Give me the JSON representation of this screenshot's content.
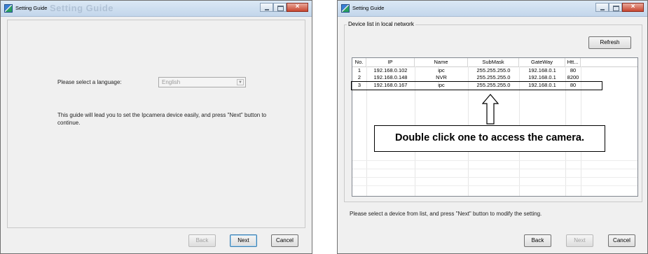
{
  "window1": {
    "title": "Setting Guide",
    "ghost_title": "Setting Guide",
    "language_label": "Please select a language:",
    "language_value": "English",
    "guide_text_line1": "This guide will lead you to set the Ipcamera device easily, and press \"Next\" button to",
    "guide_text_line2": "continue.",
    "buttons": {
      "back": "Back",
      "next": "Next",
      "cancel": "Cancel"
    }
  },
  "window2": {
    "title": "Setting Guide",
    "group_label": "Device list in local network",
    "refresh_label": "Refresh",
    "columns": [
      "No.",
      "IP",
      "Name",
      "SubMask",
      "GateWay",
      "Htt..."
    ],
    "rows": [
      [
        "1",
        "192.168.0.102",
        "ipc",
        "255.255.255.0",
        "192.168.0.1",
        "80"
      ],
      [
        "2",
        "192.168.0.148",
        "NVR",
        "255.255.255.0",
        "192.168.0.1",
        "8200"
      ],
      [
        "3",
        "192.168.0.167",
        "ipc",
        "255.255.255.0",
        "192.168.0.1",
        "80"
      ]
    ],
    "callout_text": "Double click one to access the camera.",
    "hint_text": "Please select a device from list, and press \"Next\" button to modify the setting.",
    "buttons": {
      "back": "Back",
      "next": "Next",
      "cancel": "Cancel"
    }
  }
}
